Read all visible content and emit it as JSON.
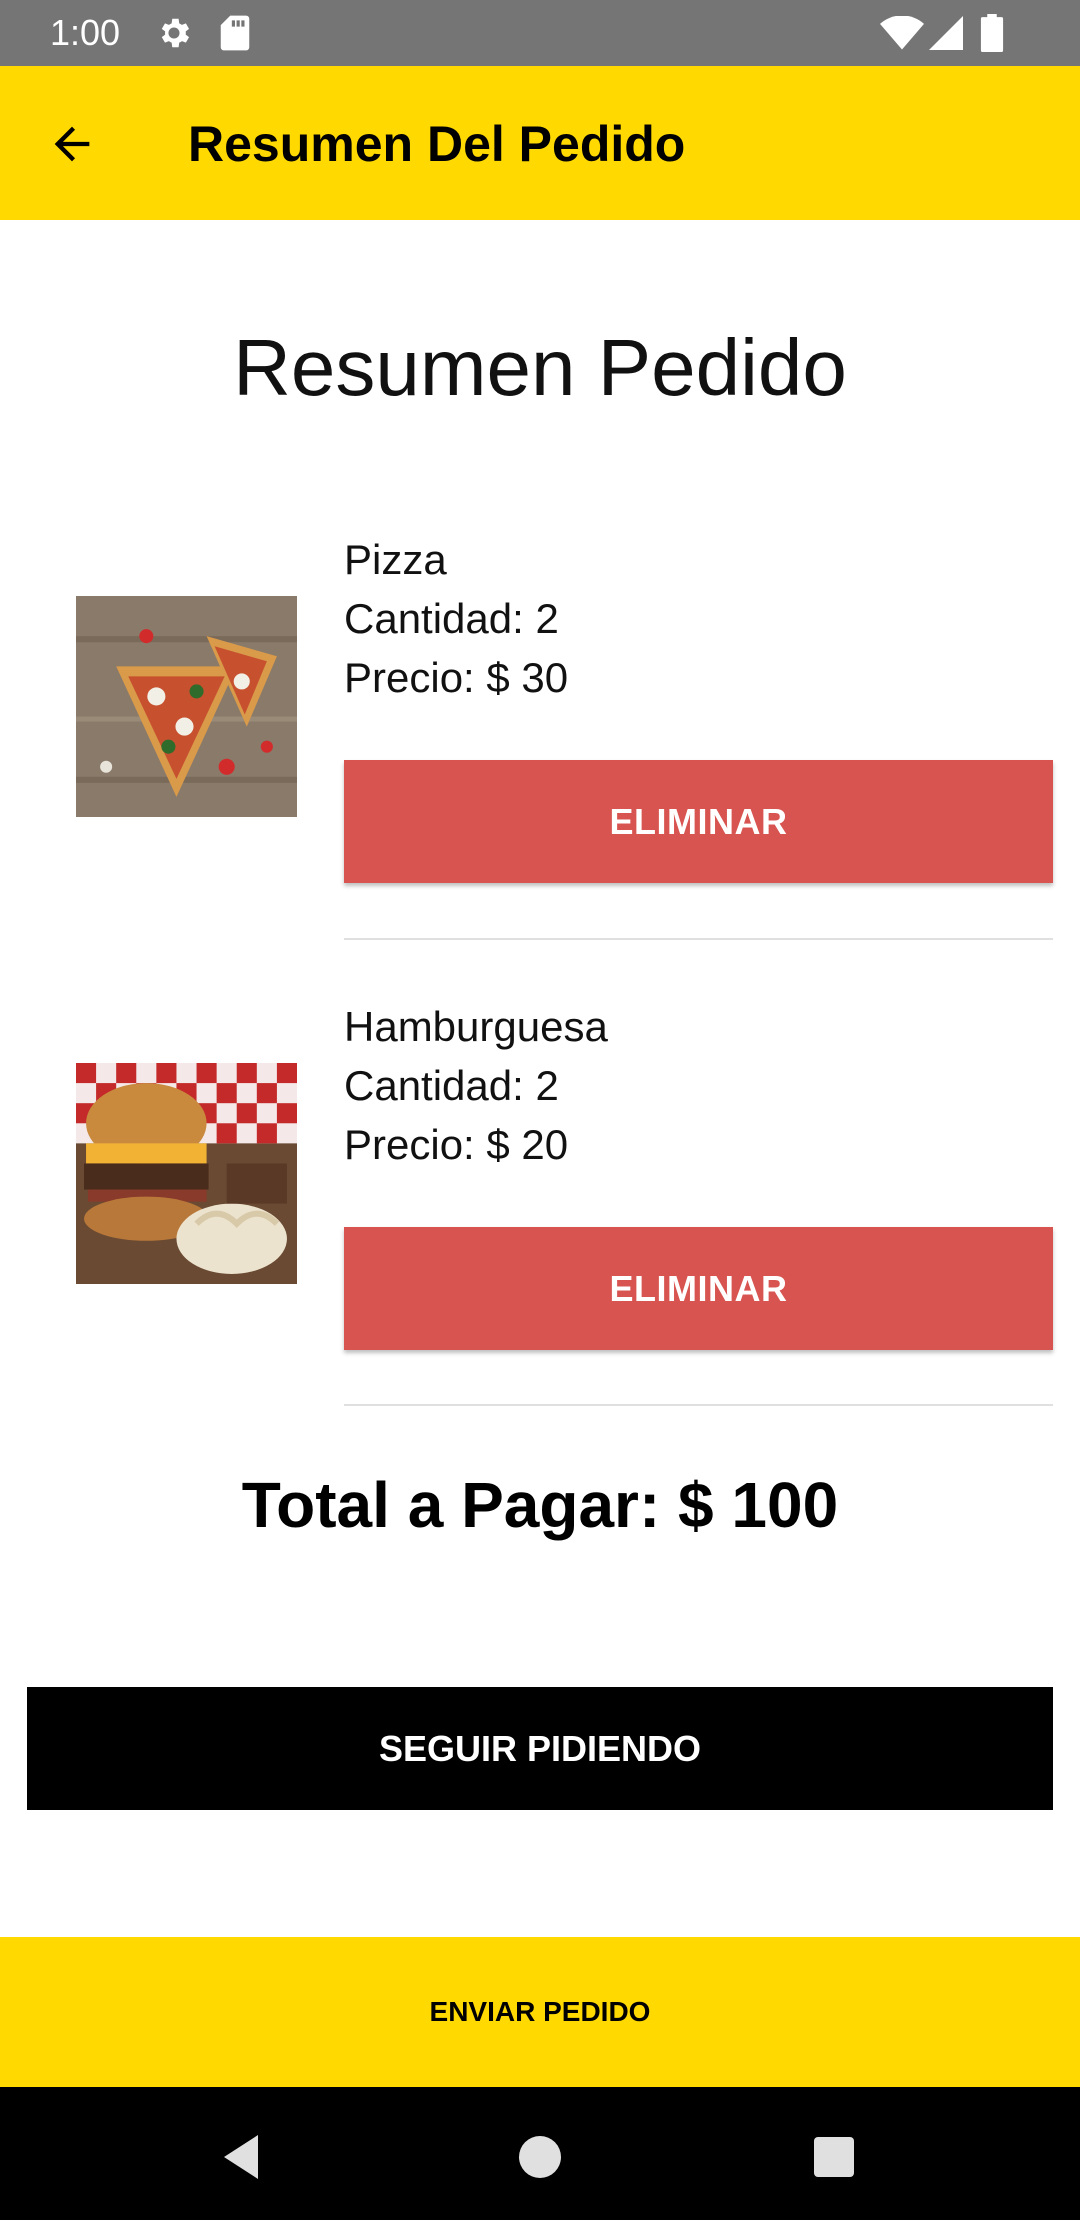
{
  "status_bar": {
    "time": "1:00",
    "left_icons": [
      "gear-icon",
      "sd-card-icon"
    ],
    "right_icons": [
      "wifi-icon",
      "signal-icon",
      "battery-icon"
    ]
  },
  "app_bar": {
    "back_icon": "arrow-left-icon",
    "title": "Resumen Del Pedido"
  },
  "main": {
    "heading": "Resumen Pedido",
    "items": [
      {
        "name": "Pizza",
        "quantity_text": "Cantidad: 2",
        "price_text": "Precio: $ 30",
        "image": "pizza-photo",
        "delete_label": "ELIMINAR"
      },
      {
        "name": "Hamburguesa",
        "quantity_text": "Cantidad: 2",
        "price_text": "Precio: $ 20",
        "image": "burger-photo",
        "delete_label": "ELIMINAR"
      }
    ],
    "total_text": "Total a Pagar: $ 100",
    "continue_label": "SEGUIR PIDIENDO",
    "send_label": "ENVIAR PEDIDO"
  },
  "nav_bar": {
    "icons": [
      "back-triangle-icon",
      "home-circle-icon",
      "recents-square-icon"
    ]
  },
  "colors": {
    "app_bar": "#FFD900",
    "delete_button": "#D85450",
    "continue_button": "#000000",
    "send_button": "#FFD900",
    "status_bar": "#757575"
  }
}
